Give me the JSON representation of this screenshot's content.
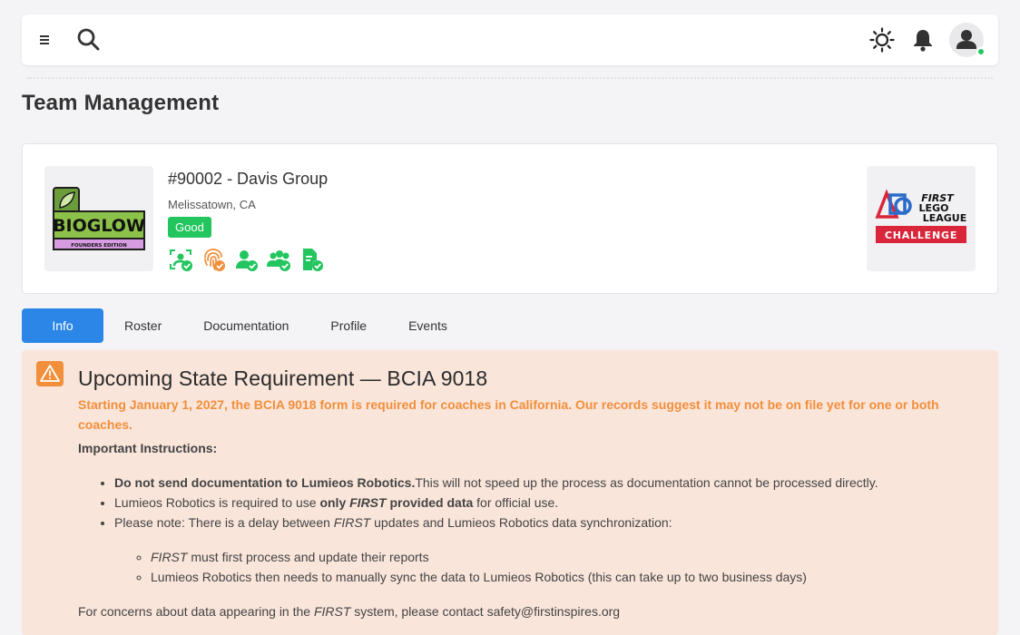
{
  "header": {
    "menu_icon": "hamburger-icon",
    "search_icon": "search-icon",
    "theme_icon": "sun-icon",
    "notifications_icon": "bell-icon",
    "avatar_icon": "user-icon",
    "online_status_color": "#22c55e"
  },
  "page": {
    "title": "Team Management"
  },
  "team": {
    "name": "#90002 - Davis Group",
    "location": "Melissatown, CA",
    "status": "Good",
    "status_color": "#22c55e",
    "logo": {
      "title": "BIOGLOW",
      "subtitle": "FOUNDERS EDITION"
    },
    "program_logo": {
      "line1": "FIRST",
      "line2": "LEGO",
      "line3": "LEAGUE",
      "badge": "CHALLENGE"
    },
    "status_icons": [
      {
        "name": "face-scan-verified-icon",
        "color": "#22c55e"
      },
      {
        "name": "fingerprint-verified-icon",
        "color": "#f28f3b"
      },
      {
        "name": "user-verified-icon",
        "color": "#22c55e"
      },
      {
        "name": "group-verified-icon",
        "color": "#22c55e"
      },
      {
        "name": "document-verified-icon",
        "color": "#22c55e"
      }
    ]
  },
  "tabs": [
    {
      "label": "Info",
      "active": true
    },
    {
      "label": "Roster",
      "active": false
    },
    {
      "label": "Documentation",
      "active": false
    },
    {
      "label": "Profile",
      "active": false
    },
    {
      "label": "Events",
      "active": false
    }
  ],
  "alert": {
    "icon": "warning-triangle-icon",
    "accent_color": "#f28f3b",
    "background": "#f9e5da",
    "title": "Upcoming State Requirement — BCIA 9018",
    "lead": "Starting January 1, 2027, the BCIA 9018 form is required for coaches in California. Our records suggest it may not be on file yet for one or both coaches.",
    "instructions_heading": "Important Instructions:",
    "bullet1_bold": "Do not send documentation to Lumieos Robotics.",
    "bullet1_rest": "This will not speed up the process as documentation cannot be processed directly.",
    "bullet2_pre": "Lumieos Robotics is required to use ",
    "bullet2_bold1": "only ",
    "bullet2_bold_italic": "FIRST",
    "bullet2_bold2": " provided data",
    "bullet2_post": " for official use.",
    "bullet3_pre": "Please note: There is a delay between ",
    "bullet3_italic": "FIRST",
    "bullet3_post": " updates and Lumieos Robotics data synchronization:",
    "sub1_italic": "FIRST",
    "sub1_rest": " must first process and update their reports",
    "sub2": "Lumieos Robotics then needs to manually sync the data to Lumieos Robotics (this can take up to two business days)",
    "footer_pre": "For concerns about data appearing in the ",
    "footer_italic": "FIRST",
    "footer_post": " system, please contact safety@firstinspires.org"
  }
}
